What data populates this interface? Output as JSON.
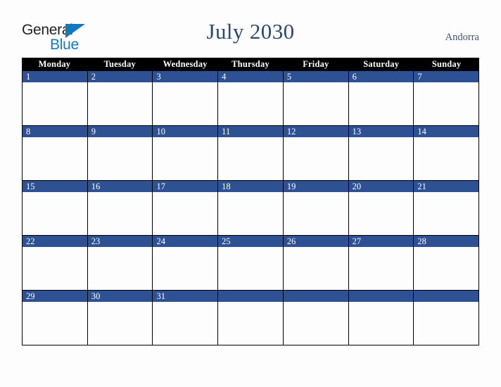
{
  "brand": {
    "name_top": "General",
    "name_bottom": "Blue",
    "triangle_icon": "blue-triangle-icon",
    "color_top": "#231f20",
    "color_bottom": "#1478be"
  },
  "header": {
    "title": "July 2030",
    "country": "Andorra",
    "title_color": "#2c4770",
    "country_color": "#3c5574"
  },
  "calendar": {
    "weekdays": [
      "Monday",
      "Tuesday",
      "Wednesday",
      "Thursday",
      "Friday",
      "Saturday",
      "Sunday"
    ],
    "weekday_row_background": "#000000",
    "weekday_text_color": "#ffffff",
    "day_band_color": "#2e5193",
    "day_number_color": "#ffffff",
    "cell_background": "#fdfdfd",
    "grid_line_color": "#000000",
    "weeks": [
      {
        "days": [
          "1",
          "2",
          "3",
          "4",
          "5",
          "6",
          "7"
        ]
      },
      {
        "days": [
          "8",
          "9",
          "10",
          "11",
          "12",
          "13",
          "14"
        ]
      },
      {
        "days": [
          "15",
          "16",
          "17",
          "18",
          "19",
          "20",
          "21"
        ]
      },
      {
        "days": [
          "22",
          "23",
          "24",
          "25",
          "26",
          "27",
          "28"
        ]
      },
      {
        "days": [
          "29",
          "30",
          "31",
          "",
          "",
          "",
          ""
        ]
      }
    ]
  }
}
